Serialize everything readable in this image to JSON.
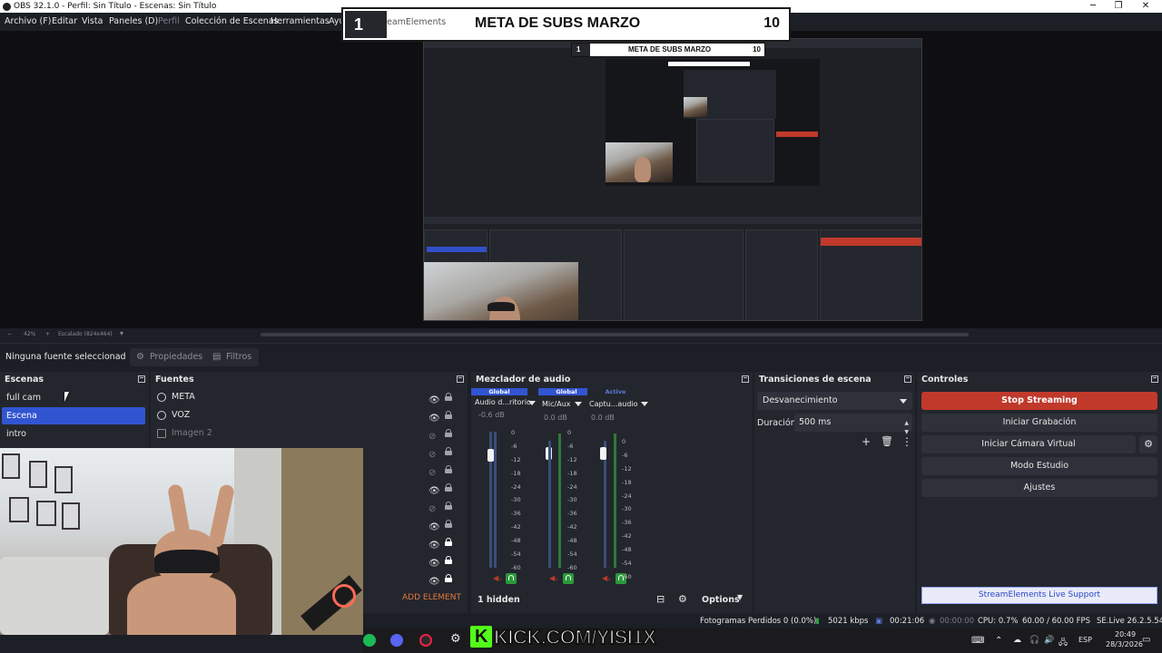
{
  "window": {
    "title": "OBS 32.1.0 - Perfil: Sin Título - Escenas: Sin Título",
    "min_glyph": "─",
    "max_glyph": "❐",
    "close_glyph": "✕"
  },
  "menu": {
    "items": [
      "Archivo (F)",
      "Editar",
      "Vista",
      "Paneles (D)",
      "Perfil",
      "Colección de Escenas",
      "Herramientas",
      "Ayu"
    ]
  },
  "overlay": {
    "goal_number": "1",
    "goal_title": "META DE SUBS MARZO",
    "goal_count": "10",
    "streamelements_text": "eamElements",
    "kick_text": "KICK.COM/YISI1X"
  },
  "zoom": {
    "percent": "42%",
    "scaled": "Escalado (824x464)"
  },
  "source_toolbar": {
    "no_source": "Ninguna fuente seleccionad",
    "properties": "Propiedades",
    "filters": "Filtros"
  },
  "scenes": {
    "title": "Escenas",
    "items": [
      "full cam",
      "Escena",
      "intro"
    ],
    "selected": "Escena"
  },
  "sources": {
    "title": "Fuentes",
    "items": [
      {
        "name": "META",
        "icon": "globe-icon"
      },
      {
        "name": "VOZ",
        "icon": "globe-icon"
      },
      {
        "name": "Imagen 2",
        "icon": "image-icon"
      }
    ],
    "add_element": "ADD ELEMENT"
  },
  "mixer": {
    "title": "Mezclador de audio",
    "channels": [
      {
        "badge": "Global",
        "name": "Audio d...ritorio",
        "db": "-0.6 dB",
        "level": 0.85
      },
      {
        "badge": "Global",
        "name": "Mic/Aux",
        "db": "0.0 dB",
        "level": 0.86
      },
      {
        "badge": "Active",
        "name": "Captu...audio",
        "db": "0.0 dB",
        "level": 0.86
      }
    ],
    "scale": [
      "0",
      "-6",
      "-12",
      "-18",
      "-24",
      "-30",
      "-36",
      "-42",
      "-48",
      "-54",
      "-60"
    ],
    "hidden": "1 hidden",
    "options": "Options"
  },
  "transitions": {
    "title": "Transiciones de escena",
    "selected": "Desvanecimiento",
    "duration_label": "Duración",
    "duration_value": "500 ms"
  },
  "controls": {
    "title": "Controles",
    "stop_streaming": "Stop Streaming",
    "start_recording": "Iniciar Grabación",
    "start_virtualcam": "Iniciar Cámara Virtual",
    "studio_mode": "Modo Estudio",
    "settings": "Ajustes",
    "se_support": "StreamElements Live Support"
  },
  "status": {
    "dropped_frames": "Fotogramas Perdidos 0 (0.0%)",
    "bitrate": "5021 kbps",
    "live_time": "00:21:06",
    "rec_time": "00:00:00",
    "cpu": "CPU: 0.7%",
    "fps": "60.00 / 60.00 FPS",
    "se_version": "SE.Live 26.2.5.549"
  },
  "taskbar": {
    "lang": "ESP",
    "time": "20:49",
    "date": "28/3/2026"
  },
  "colors": {
    "accent_blue": "#3155d1",
    "stop_red": "#c0392b",
    "kick_green": "#53fc18"
  }
}
